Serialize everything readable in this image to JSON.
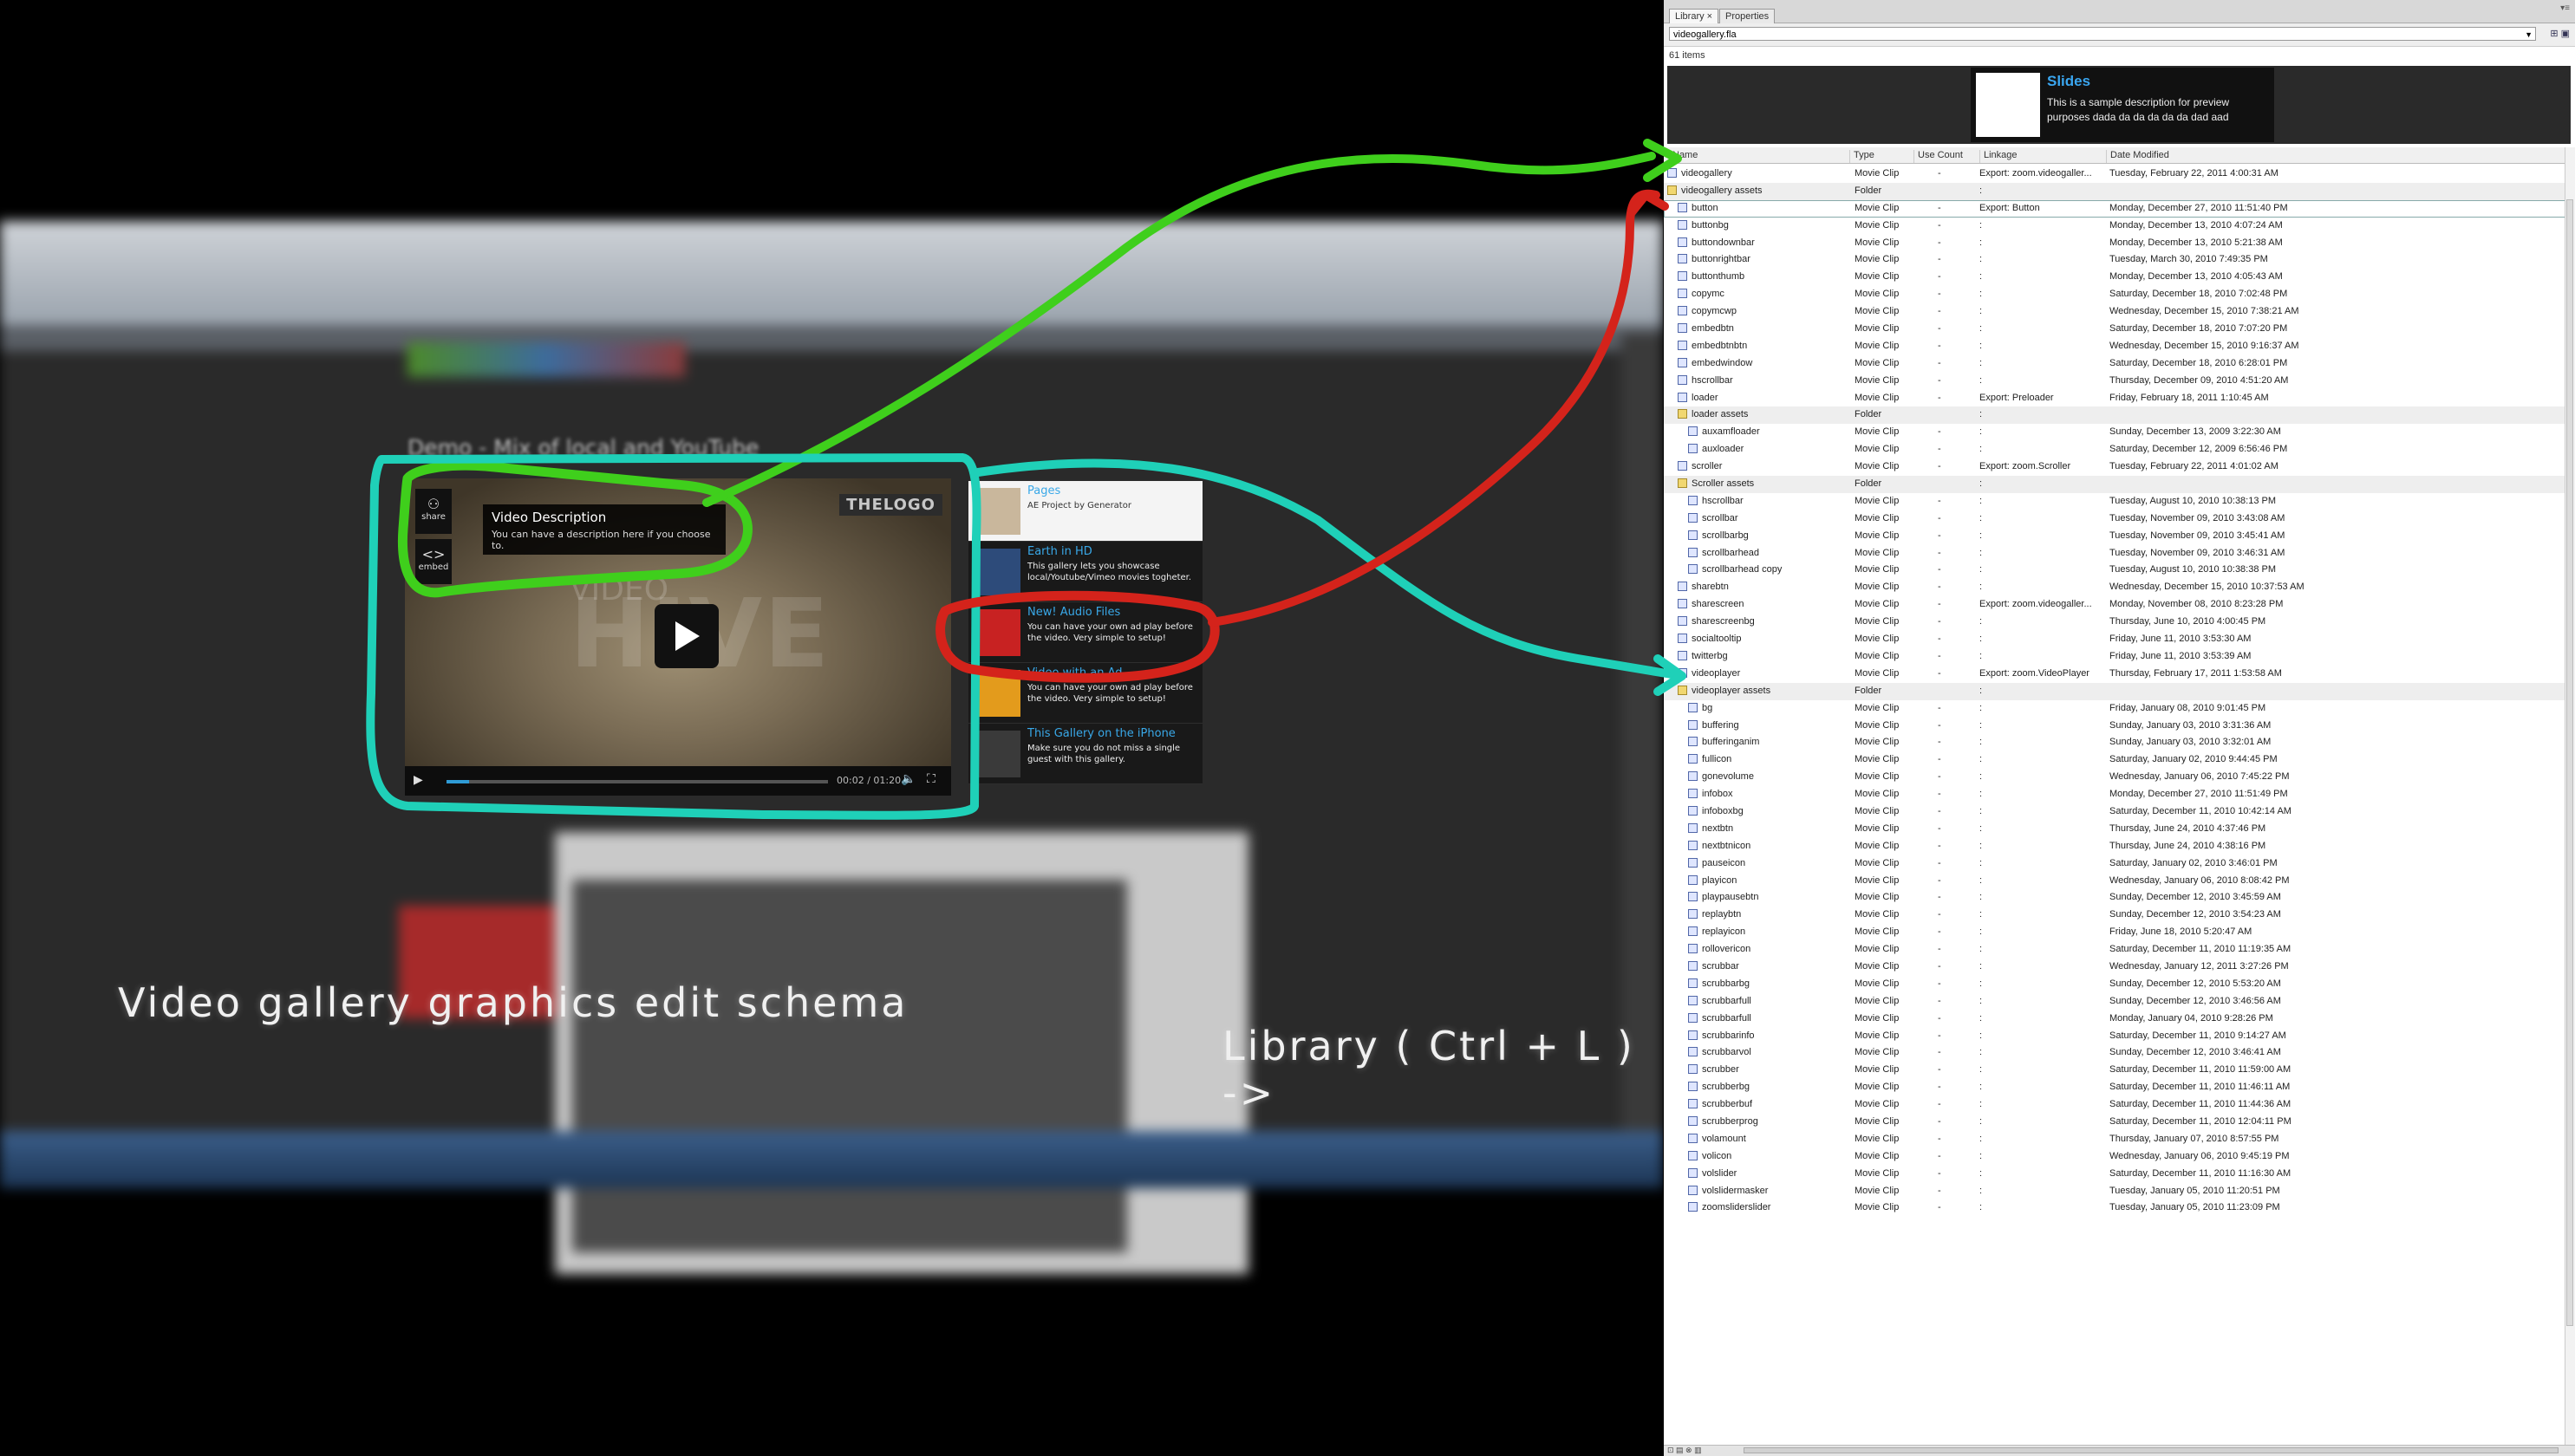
{
  "left": {
    "demo_heading": "Demo - Mix of local and YouTube",
    "caption_main": "Video gallery graphics edit schema",
    "caption_library": "Library ( Ctrl + L ) ->"
  },
  "player": {
    "logo": "THELOGO",
    "watermark": "HIVE",
    "watermark_small": "VIDEO",
    "share_label": "share",
    "embed_label": "embed",
    "description_title": "Video Description",
    "description_text": "You can have a description here if you choose to.",
    "time": "00:02 / 01:20",
    "progress": 0.06
  },
  "playlist": {
    "items": [
      {
        "title": "Pages",
        "text": "AE Project by Generator",
        "thumb_color": "#c9b79c"
      },
      {
        "title": "Earth in HD",
        "text": "This gallery lets you showcase local/Youtube/Vimeo movies togheter.",
        "thumb_color": "#2d4b7a"
      },
      {
        "title": "New! Audio Files",
        "text": "You can have your own ad play before the video. Very simple to setup!",
        "thumb_color": "#c82222"
      },
      {
        "title": "Video with an Ad",
        "text": "You can have your own ad play before the video. Very simple to setup!",
        "thumb_color": "#e39b1c"
      },
      {
        "title": "This Gallery on the iPhone",
        "text": "Make sure you do not miss a single guest with this gallery.",
        "thumb_color": "#3a3a3a"
      }
    ]
  },
  "library": {
    "tabs": [
      "Library",
      "Properties"
    ],
    "document": "videogallery.fla",
    "item_count": "61 items",
    "preview": {
      "title": "Slides",
      "text": "This is a sample description for preview purposes dada da da da da da dad aad"
    },
    "columns": [
      "Name",
      "Type",
      "Use Count",
      "Linkage",
      "Date Modified"
    ],
    "rows": [
      {
        "name": "videogallery",
        "type": "Movie Clip",
        "use": "-",
        "link": "Export: zoom.videogaller...",
        "date": "Tuesday, February 22, 2011  4:00:31 AM",
        "indent": 0,
        "kind": "clip"
      },
      {
        "name": "videogallery assets",
        "type": "Folder",
        "use": "",
        "link": ":",
        "date": "",
        "indent": 0,
        "kind": "folder"
      },
      {
        "name": "button",
        "type": "Movie Clip",
        "use": "-",
        "link": "Export: Button",
        "date": "Monday, December 27, 2010  11:51:40 PM",
        "indent": 1,
        "kind": "clip"
      },
      {
        "name": "buttonbg",
        "type": "Movie Clip",
        "use": "-",
        "link": ":",
        "date": "Monday, December 13, 2010  4:07:24 AM",
        "indent": 1,
        "kind": "clip"
      },
      {
        "name": "buttondownbar",
        "type": "Movie Clip",
        "use": "-",
        "link": ":",
        "date": "Monday, December 13, 2010  5:21:38 AM",
        "indent": 1,
        "kind": "clip"
      },
      {
        "name": "buttonrightbar",
        "type": "Movie Clip",
        "use": "-",
        "link": ":",
        "date": "Tuesday, March 30, 2010  7:49:35 PM",
        "indent": 1,
        "kind": "clip"
      },
      {
        "name": "buttonthumb",
        "type": "Movie Clip",
        "use": "-",
        "link": ":",
        "date": "Monday, December 13, 2010  4:05:43 AM",
        "indent": 1,
        "kind": "clip"
      },
      {
        "name": "copymc",
        "type": "Movie Clip",
        "use": "-",
        "link": ":",
        "date": "Saturday, December 18, 2010  7:02:48 PM",
        "indent": 1,
        "kind": "clip"
      },
      {
        "name": "copymcwp",
        "type": "Movie Clip",
        "use": "-",
        "link": ":",
        "date": "Wednesday, December 15, 2010  7:38:21 AM",
        "indent": 1,
        "kind": "clip"
      },
      {
        "name": "embedbtn",
        "type": "Movie Clip",
        "use": "-",
        "link": ":",
        "date": "Saturday, December 18, 2010  7:07:20 PM",
        "indent": 1,
        "kind": "clip"
      },
      {
        "name": "embedbtnbtn",
        "type": "Movie Clip",
        "use": "-",
        "link": ":",
        "date": "Wednesday, December 15, 2010  9:16:37 AM",
        "indent": 1,
        "kind": "clip"
      },
      {
        "name": "embedwindow",
        "type": "Movie Clip",
        "use": "-",
        "link": ":",
        "date": "Saturday, December 18, 2010  6:28:01 PM",
        "indent": 1,
        "kind": "clip"
      },
      {
        "name": "hscrollbar",
        "type": "Movie Clip",
        "use": "-",
        "link": ":",
        "date": "Thursday, December 09, 2010  4:51:20 AM",
        "indent": 1,
        "kind": "clip"
      },
      {
        "name": "loader",
        "type": "Movie Clip",
        "use": "-",
        "link": "Export: Preloader",
        "date": "Friday, February 18, 2011  1:10:45 AM",
        "indent": 1,
        "kind": "clip"
      },
      {
        "name": "loader assets",
        "type": "Folder",
        "use": "",
        "link": ":",
        "date": "",
        "indent": 1,
        "kind": "folder"
      },
      {
        "name": "auxamfloader",
        "type": "Movie Clip",
        "use": "-",
        "link": ":",
        "date": "Sunday, December 13, 2009  3:22:30 AM",
        "indent": 2,
        "kind": "clip"
      },
      {
        "name": "auxloader",
        "type": "Movie Clip",
        "use": "-",
        "link": ":",
        "date": "Saturday, December 12, 2009  6:56:46 PM",
        "indent": 2,
        "kind": "clip"
      },
      {
        "name": "scroller",
        "type": "Movie Clip",
        "use": "-",
        "link": "Export: zoom.Scroller",
        "date": "Tuesday, February 22, 2011  4:01:02 AM",
        "indent": 1,
        "kind": "clip"
      },
      {
        "name": "Scroller assets",
        "type": "Folder",
        "use": "",
        "link": ":",
        "date": "",
        "indent": 1,
        "kind": "folder"
      },
      {
        "name": "hscrollbar",
        "type": "Movie Clip",
        "use": "-",
        "link": ":",
        "date": "Tuesday, August 10, 2010  10:38:13 PM",
        "indent": 2,
        "kind": "clip"
      },
      {
        "name": "scrollbar",
        "type": "Movie Clip",
        "use": "-",
        "link": ":",
        "date": "Tuesday, November 09, 2010  3:43:08 AM",
        "indent": 2,
        "kind": "clip"
      },
      {
        "name": "scrollbarbg",
        "type": "Movie Clip",
        "use": "-",
        "link": ":",
        "date": "Tuesday, November 09, 2010  3:45:41 AM",
        "indent": 2,
        "kind": "clip"
      },
      {
        "name": "scrollbarhead",
        "type": "Movie Clip",
        "use": "-",
        "link": ":",
        "date": "Tuesday, November 09, 2010  3:46:31 AM",
        "indent": 2,
        "kind": "clip"
      },
      {
        "name": "scrollbarhead copy",
        "type": "Movie Clip",
        "use": "-",
        "link": ":",
        "date": "Tuesday, August 10, 2010  10:38:38 PM",
        "indent": 2,
        "kind": "clip"
      },
      {
        "name": "sharebtn",
        "type": "Movie Clip",
        "use": "-",
        "link": ":",
        "date": "Wednesday, December 15, 2010  10:37:53 AM",
        "indent": 1,
        "kind": "clip"
      },
      {
        "name": "sharescreen",
        "type": "Movie Clip",
        "use": "-",
        "link": "Export: zoom.videogaller...",
        "date": "Monday, November 08, 2010  8:23:28 PM",
        "indent": 1,
        "kind": "clip"
      },
      {
        "name": "sharescreenbg",
        "type": "Movie Clip",
        "use": "-",
        "link": ":",
        "date": "Thursday, June 10, 2010  4:00:45 PM",
        "indent": 1,
        "kind": "clip"
      },
      {
        "name": "socialtooltip",
        "type": "Movie Clip",
        "use": "-",
        "link": ":",
        "date": "Friday, June 11, 2010  3:53:30 AM",
        "indent": 1,
        "kind": "clip"
      },
      {
        "name": "twitterbg",
        "type": "Movie Clip",
        "use": "-",
        "link": ":",
        "date": "Friday, June 11, 2010  3:53:39 AM",
        "indent": 1,
        "kind": "clip"
      },
      {
        "name": "videoplayer",
        "type": "Movie Clip",
        "use": "-",
        "link": "Export: zoom.VideoPlayer",
        "date": "Thursday, February 17, 2011  1:53:58 AM",
        "indent": 1,
        "kind": "clip"
      },
      {
        "name": "videoplayer assets",
        "type": "Folder",
        "use": "",
        "link": ":",
        "date": "",
        "indent": 1,
        "kind": "folder"
      },
      {
        "name": "bg",
        "type": "Movie Clip",
        "use": "-",
        "link": ":",
        "date": "Friday, January 08, 2010  9:01:45 PM",
        "indent": 2,
        "kind": "clip"
      },
      {
        "name": "buffering",
        "type": "Movie Clip",
        "use": "-",
        "link": ":",
        "date": "Sunday, January 03, 2010  3:31:36 AM",
        "indent": 2,
        "kind": "clip"
      },
      {
        "name": "bufferinganim",
        "type": "Movie Clip",
        "use": "-",
        "link": ":",
        "date": "Sunday, January 03, 2010  3:32:01 AM",
        "indent": 2,
        "kind": "clip"
      },
      {
        "name": "fullicon",
        "type": "Movie Clip",
        "use": "-",
        "link": ":",
        "date": "Saturday, January 02, 2010  9:44:45 PM",
        "indent": 2,
        "kind": "clip"
      },
      {
        "name": "gonevolume",
        "type": "Movie Clip",
        "use": "-",
        "link": ":",
        "date": "Wednesday, January 06, 2010  7:45:22 PM",
        "indent": 2,
        "kind": "clip"
      },
      {
        "name": "infobox",
        "type": "Movie Clip",
        "use": "-",
        "link": ":",
        "date": "Monday, December 27, 2010  11:51:49 PM",
        "indent": 2,
        "kind": "clip"
      },
      {
        "name": "infoboxbg",
        "type": "Movie Clip",
        "use": "-",
        "link": ":",
        "date": "Saturday, December 11, 2010  10:42:14 AM",
        "indent": 2,
        "kind": "clip"
      },
      {
        "name": "nextbtn",
        "type": "Movie Clip",
        "use": "-",
        "link": ":",
        "date": "Thursday, June 24, 2010  4:37:46 PM",
        "indent": 2,
        "kind": "clip"
      },
      {
        "name": "nextbtnicon",
        "type": "Movie Clip",
        "use": "-",
        "link": ":",
        "date": "Thursday, June 24, 2010  4:38:16 PM",
        "indent": 2,
        "kind": "clip"
      },
      {
        "name": "pauseicon",
        "type": "Movie Clip",
        "use": "-",
        "link": ":",
        "date": "Saturday, January 02, 2010  3:46:01 PM",
        "indent": 2,
        "kind": "clip"
      },
      {
        "name": "playicon",
        "type": "Movie Clip",
        "use": "-",
        "link": ":",
        "date": "Wednesday, January 06, 2010  8:08:42 PM",
        "indent": 2,
        "kind": "clip"
      },
      {
        "name": "playpausebtn",
        "type": "Movie Clip",
        "use": "-",
        "link": ":",
        "date": "Sunday, December 12, 2010  3:45:59 AM",
        "indent": 2,
        "kind": "clip"
      },
      {
        "name": "replaybtn",
        "type": "Movie Clip",
        "use": "-",
        "link": ":",
        "date": "Sunday, December 12, 2010  3:54:23 AM",
        "indent": 2,
        "kind": "clip"
      },
      {
        "name": "replayicon",
        "type": "Movie Clip",
        "use": "-",
        "link": ":",
        "date": "Friday, June 18, 2010  5:20:47 AM",
        "indent": 2,
        "kind": "clip"
      },
      {
        "name": "rollovericon",
        "type": "Movie Clip",
        "use": "-",
        "link": ":",
        "date": "Saturday, December 11, 2010  11:19:35 AM",
        "indent": 2,
        "kind": "clip"
      },
      {
        "name": "scrubbar",
        "type": "Movie Clip",
        "use": "-",
        "link": ":",
        "date": "Wednesday, January 12, 2011  3:27:26 PM",
        "indent": 2,
        "kind": "clip"
      },
      {
        "name": "scrubbarbg",
        "type": "Movie Clip",
        "use": "-",
        "link": ":",
        "date": "Sunday, December 12, 2010  5:53:20 AM",
        "indent": 2,
        "kind": "clip"
      },
      {
        "name": "scrubbarfull",
        "type": "Movie Clip",
        "use": "-",
        "link": ":",
        "date": "Sunday, December 12, 2010  3:46:56 AM",
        "indent": 2,
        "kind": "clip"
      },
      {
        "name": "scrubbarfull",
        "type": "Movie Clip",
        "use": "-",
        "link": ":",
        "date": "Monday, January 04, 2010  9:28:26 PM",
        "indent": 2,
        "kind": "clip"
      },
      {
        "name": "scrubbarinfo",
        "type": "Movie Clip",
        "use": "-",
        "link": ":",
        "date": "Saturday, December 11, 2010  9:14:27 AM",
        "indent": 2,
        "kind": "clip"
      },
      {
        "name": "scrubbarvol",
        "type": "Movie Clip",
        "use": "-",
        "link": ":",
        "date": "Sunday, December 12, 2010  3:46:41 AM",
        "indent": 2,
        "kind": "clip"
      },
      {
        "name": "scrubber",
        "type": "Movie Clip",
        "use": "-",
        "link": ":",
        "date": "Saturday, December 11, 2010  11:59:00 AM",
        "indent": 2,
        "kind": "clip"
      },
      {
        "name": "scrubberbg",
        "type": "Movie Clip",
        "use": "-",
        "link": ":",
        "date": "Saturday, December 11, 2010  11:46:11 AM",
        "indent": 2,
        "kind": "clip"
      },
      {
        "name": "scrubberbuf",
        "type": "Movie Clip",
        "use": "-",
        "link": ":",
        "date": "Saturday, December 11, 2010  11:44:36 AM",
        "indent": 2,
        "kind": "clip"
      },
      {
        "name": "scrubberprog",
        "type": "Movie Clip",
        "use": "-",
        "link": ":",
        "date": "Saturday, December 11, 2010  12:04:11 PM",
        "indent": 2,
        "kind": "clip"
      },
      {
        "name": "volamount",
        "type": "Movie Clip",
        "use": "-",
        "link": ":",
        "date": "Thursday, January 07, 2010  8:57:55 PM",
        "indent": 2,
        "kind": "clip"
      },
      {
        "name": "volicon",
        "type": "Movie Clip",
        "use": "-",
        "link": ":",
        "date": "Wednesday, January 06, 2010  9:45:19 PM",
        "indent": 2,
        "kind": "clip"
      },
      {
        "name": "volslider",
        "type": "Movie Clip",
        "use": "-",
        "link": ":",
        "date": "Saturday, December 11, 2010  11:16:30 AM",
        "indent": 2,
        "kind": "clip"
      },
      {
        "name": "volslidermasker",
        "type": "Movie Clip",
        "use": "-",
        "link": ":",
        "date": "Tuesday, January 05, 2010  11:20:51 PM",
        "indent": 2,
        "kind": "clip"
      },
      {
        "name": "zoomsliderslider",
        "type": "Movie Clip",
        "use": "-",
        "link": ":",
        "date": "Tuesday, January 05, 2010  11:23:09 PM",
        "indent": 2,
        "kind": "clip"
      }
    ]
  },
  "colors": {
    "green_arrow": "#3fcf1c",
    "cyan_arrow": "#1fd0b8",
    "red_arrow": "#d4231b",
    "accent_blue": "#39a8e8"
  }
}
